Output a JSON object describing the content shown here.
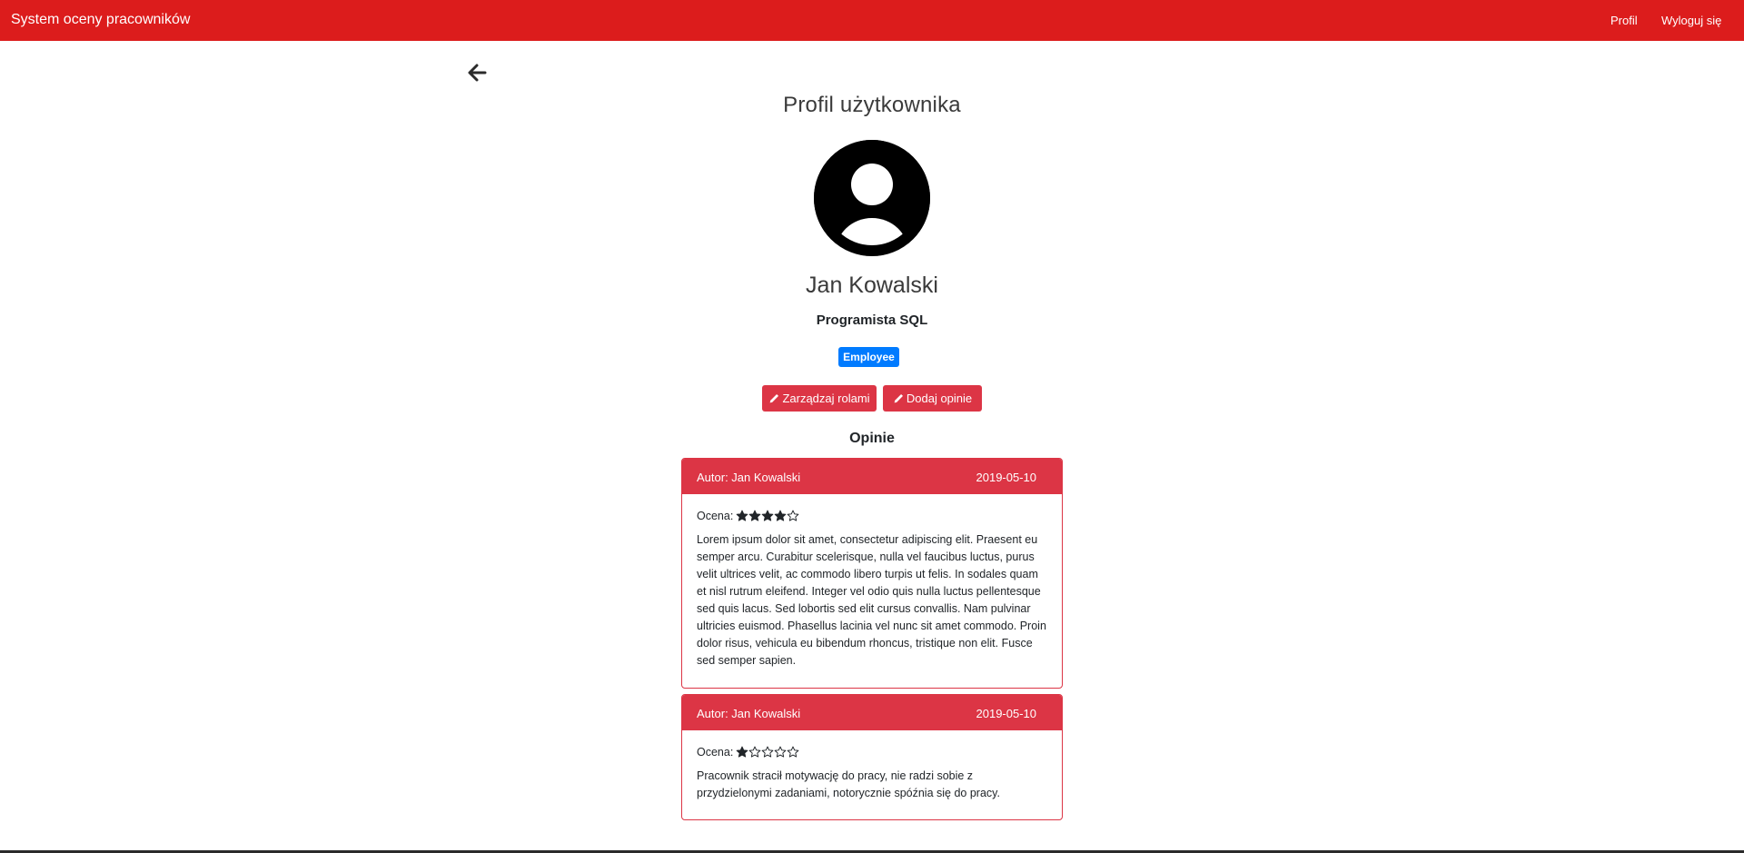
{
  "app": {
    "title": "System oceny pracowników"
  },
  "nav": {
    "profile": "Profil",
    "logout": "Wyloguj się"
  },
  "page": {
    "title": "Profil użytkownika"
  },
  "user": {
    "name": "Jan Kowalski",
    "position": "Programista SQL",
    "role": "Employee"
  },
  "actions": {
    "manage_roles": "Zarządzaj rolami",
    "add_opinion": "Dodaj opinie"
  },
  "opinions": {
    "title": "Opinie",
    "items": [
      {
        "author": "Autor: Jan Kowalski",
        "date": "2019-05-10",
        "rating_label": "Ocena:",
        "rating": 4,
        "rating_max": 5,
        "text": "Lorem ipsum dolor sit amet, consectetur adipiscing elit. Praesent eu semper arcu. Curabitur scelerisque, nulla vel faucibus luctus, purus velit ultrices velit, ac commodo libero turpis ut felis. In sodales quam et nisl rutrum eleifend. Integer vel odio quis nulla luctus pellentesque sed quis lacus. Sed lobortis sed elit cursus convallis. Nam pulvinar ultricies euismod. Phasellus lacinia vel nunc sit amet commodo. Proin dolor risus, vehicula eu bibendum rhoncus, tristique non elit. Fusce sed semper sapien."
      },
      {
        "author": "Autor: Jan Kowalski",
        "date": "2019-05-10",
        "rating_label": "Ocena:",
        "rating": 1,
        "rating_max": 5,
        "text": "Pracownik stracił motywację do pracy, nie radzi sobie z przydzielonymi zadaniami, notorycznie spóźnia się do pracy."
      }
    ]
  },
  "colors": {
    "navbar": "#dc1c1c",
    "danger": "#dc3545",
    "primary": "#007bff"
  },
  "icons": {
    "back": "arrow-left-icon",
    "avatar": "user-circle-icon",
    "edit": "pencil-icon",
    "star_full": "star-filled-icon",
    "star_empty": "star-outline-icon"
  }
}
